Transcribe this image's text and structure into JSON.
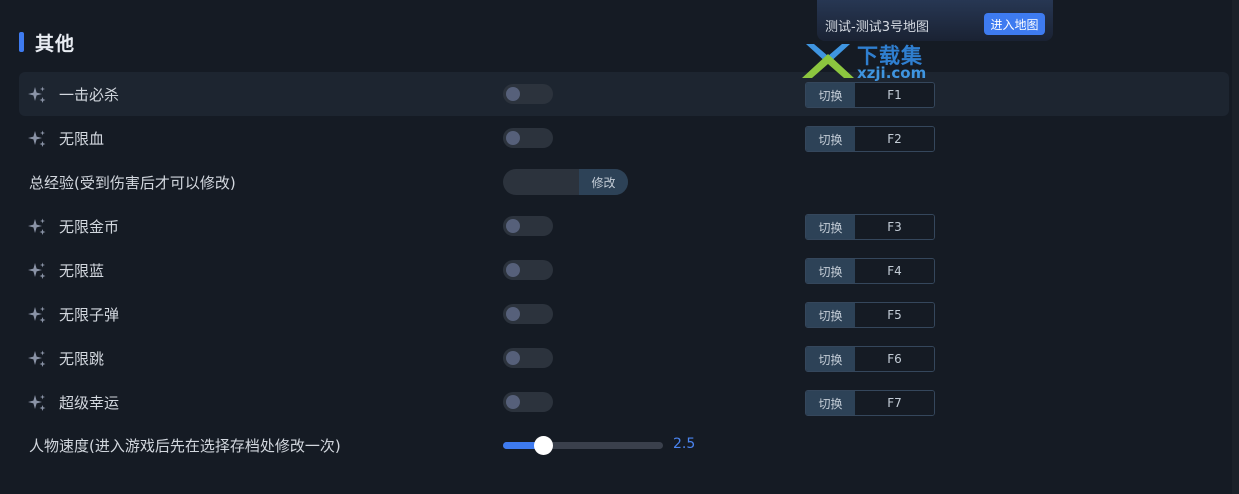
{
  "section": {
    "title": "其他"
  },
  "map_panel": {
    "text": "测试-测试3号地图",
    "button": "进入地图"
  },
  "watermark": {
    "title": "下载集",
    "url": "xzji.com"
  },
  "rows": [
    {
      "label": "一击必杀",
      "icon": "sparkle-icon",
      "enabled": false,
      "hotkey_action": "切换",
      "hotkey_key": "F1"
    },
    {
      "label": "无限血",
      "icon": "sparkle-icon",
      "enabled": false,
      "hotkey_action": "切换",
      "hotkey_key": "F2"
    },
    {
      "label": "总经验(受到伤害后才可以修改)",
      "input_value": "",
      "modify_button": "修改"
    },
    {
      "label": "无限金币",
      "icon": "sparkle-icon",
      "enabled": false,
      "hotkey_action": "切换",
      "hotkey_key": "F3"
    },
    {
      "label": "无限蓝",
      "icon": "sparkle-icon",
      "enabled": false,
      "hotkey_action": "切换",
      "hotkey_key": "F4"
    },
    {
      "label": "无限子弹",
      "icon": "sparkle-icon",
      "enabled": false,
      "hotkey_action": "切换",
      "hotkey_key": "F5"
    },
    {
      "label": "无限跳",
      "icon": "sparkle-icon",
      "enabled": false,
      "hotkey_action": "切换",
      "hotkey_key": "F6"
    },
    {
      "label": "超级幸运",
      "icon": "sparkle-icon",
      "enabled": false,
      "hotkey_action": "切换",
      "hotkey_key": "F7"
    },
    {
      "label": "人物速度(进入游戏后先在选择存档处修改一次)",
      "slider_fraction": 0.25,
      "slider_value": "2.5"
    }
  ],
  "colors": {
    "accent": "#3e7bf0",
    "background": "#151b24"
  }
}
